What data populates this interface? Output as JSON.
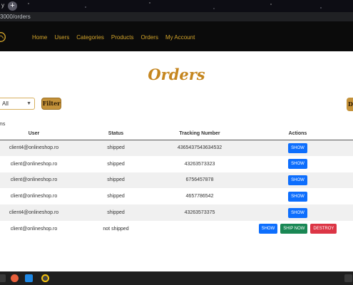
{
  "browser": {
    "tab_fragment": "y",
    "new_tab": "+",
    "address": "3000/orders"
  },
  "nav": {
    "items": [
      "Home",
      "Users",
      "Categories",
      "Products",
      "Orders",
      "My Account"
    ]
  },
  "page": {
    "title": "Orders",
    "select_value": "All",
    "filter_label": "Filter",
    "right_button_label": "D",
    "items_label": "ms"
  },
  "table": {
    "headers": [
      "User",
      "Status",
      "Tracking Number",
      "Actions"
    ],
    "rows": [
      {
        "user": "client4@onlineshop.ro",
        "status": "shipped",
        "tracking": "4365437543634532",
        "actions": [
          "SHOW"
        ]
      },
      {
        "user": "client@onlineshop.ro",
        "status": "shipped",
        "tracking": "43263573323",
        "actions": [
          "SHOW"
        ]
      },
      {
        "user": "client@onlineshop.ro",
        "status": "shipped",
        "tracking": "6756457878",
        "actions": [
          "SHOW"
        ]
      },
      {
        "user": "client@onlineshop.ro",
        "status": "shipped",
        "tracking": "4657786542",
        "actions": [
          "SHOW"
        ]
      },
      {
        "user": "client4@onlineshop.ro",
        "status": "shipped",
        "tracking": "43263573375",
        "actions": [
          "SHOW"
        ]
      },
      {
        "user": "client@onlineshop.ro",
        "status": "not shipped",
        "tracking": "",
        "actions": [
          "SHOW",
          "SHIP NOW",
          "DESTROY"
        ]
      }
    ]
  },
  "colors": {
    "accent": "#c5861f",
    "nav_link": "#d4a52b",
    "show": "#0d6efd",
    "ship": "#198754",
    "destroy": "#dc3545"
  }
}
